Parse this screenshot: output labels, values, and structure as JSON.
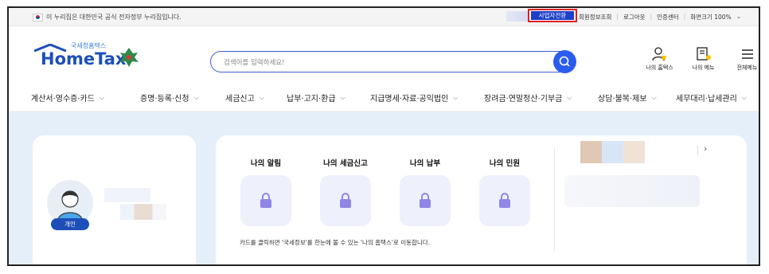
{
  "topbar": {
    "gov_notice": "이 누리집은 대한민국 공식 전자정부 누리집입니다.",
    "business_switch": "사업자전환",
    "links": [
      "회원정보조회",
      "로그아웃",
      "인증센터",
      "화면크기 100%"
    ]
  },
  "header": {
    "logo_sub": "국세청홈택스",
    "logo_main": "HomeTax",
    "search": {
      "placeholder": "검색어를 입력하세요!"
    },
    "icons": [
      {
        "label": "나의 홈택스",
        "icon": "person-bell-icon"
      },
      {
        "label": "나의 메뉴",
        "icon": "menu-person-icon"
      },
      {
        "label": "전체메뉴",
        "icon": "hamburger-icon"
      }
    ]
  },
  "nav": {
    "items": [
      "계산서·영수증·카드",
      "증명·등록·신청",
      "세금신고",
      "납부·고지·환급",
      "지급명세·자료·공익법인",
      "장려금·연말정산·기부금",
      "상담·불복·제보",
      "세무대리·납세관리"
    ]
  },
  "profile": {
    "badge": "개인"
  },
  "mycards": {
    "tiles": [
      "나의 알림",
      "나의 세금신고",
      "나의 납부",
      "나의 민원"
    ],
    "note": "카드를 클릭하면 '국세정보'를 한눈에 볼 수 있는 '나의 홈택스'로 이동합니다.",
    "next_arrow": "›"
  },
  "colors": {
    "brand": "#1e4fb8",
    "accent": "#2b5cf0",
    "highlight_border": "#e02020",
    "tile_bg": "#eef0fb",
    "lock": "#8e87e6",
    "page_bg": "#e4effa"
  }
}
